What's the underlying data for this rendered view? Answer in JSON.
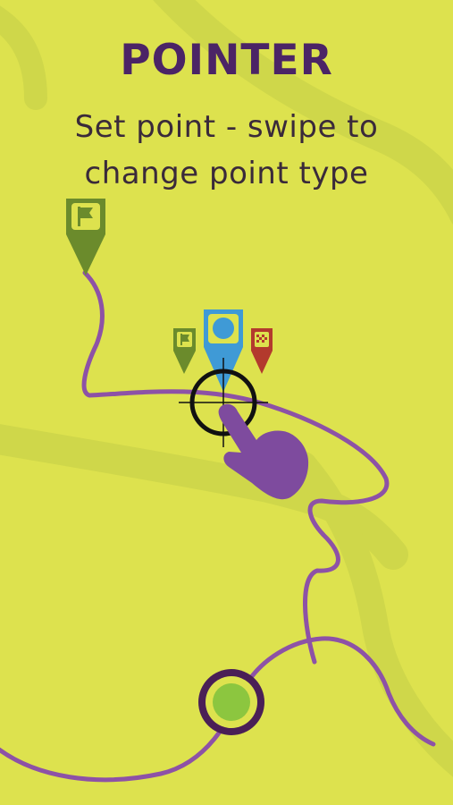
{
  "colors": {
    "background": "#dde24e",
    "road": "#cdd64a",
    "title": "#4b2466",
    "subtitle": "#3a2a3a",
    "route": "#8d52a6",
    "start_pin": "#6b8b2c",
    "active_pin": "#3f9ad6",
    "end_pin": "#b33a2d",
    "crosshair": "#111111",
    "hand": "#7e4b9e",
    "location_ring": "#4a1f56",
    "location_dot": "#8cc63f"
  },
  "title": "POINTER",
  "subtitle": {
    "line1": "Set point - swipe to",
    "line2": "change point type"
  },
  "icons": {
    "start_flag": "flag-icon",
    "waypoint": "circle-marker-icon",
    "finish": "checkered-flag-icon",
    "crosshair": "crosshair-icon",
    "hand": "pointing-hand-icon",
    "location": "location-dot-icon"
  }
}
